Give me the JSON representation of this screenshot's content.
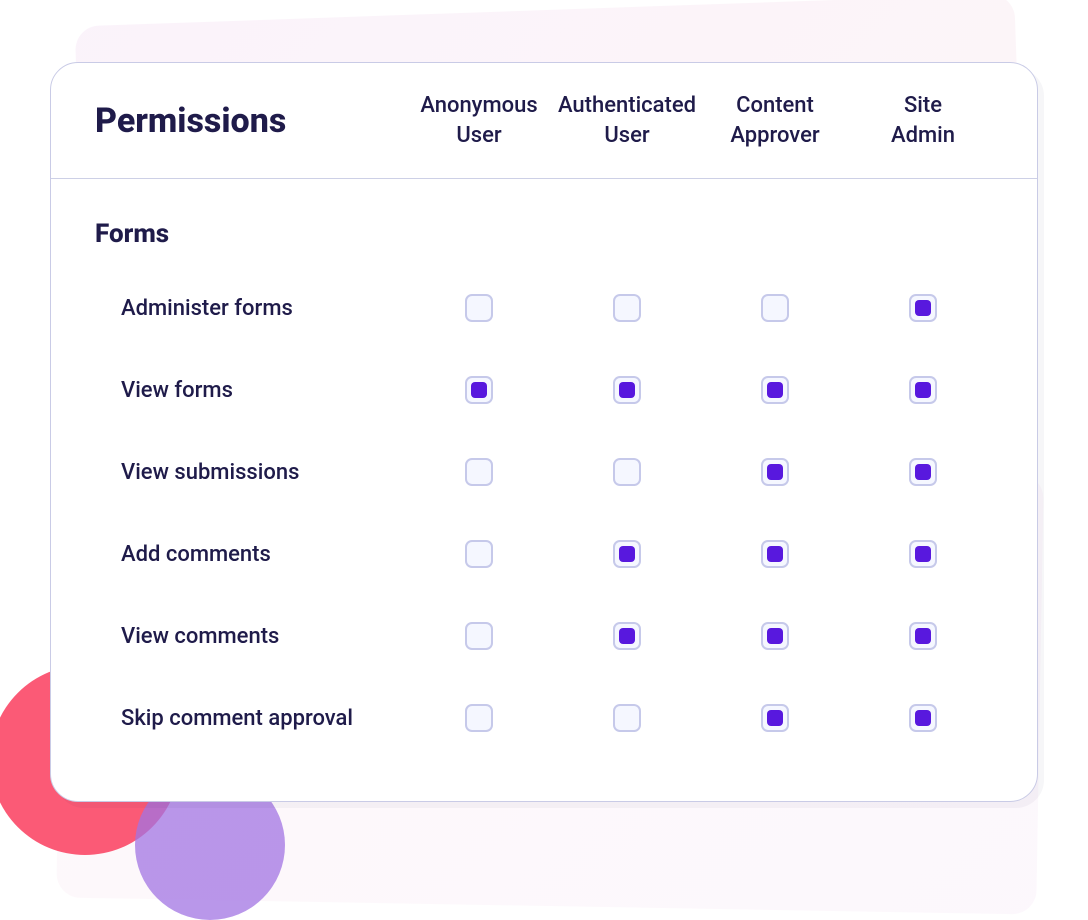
{
  "header": {
    "title": "Permissions",
    "roles": [
      {
        "line1": "Anonymous",
        "line2": "User"
      },
      {
        "line1": "Authenticated",
        "line2": "User"
      },
      {
        "line1": "Content",
        "line2": "Approver"
      },
      {
        "line1": "Site",
        "line2": "Admin"
      }
    ]
  },
  "section": {
    "heading": "Forms",
    "permissions": [
      {
        "label": "Administer forms",
        "values": [
          false,
          false,
          false,
          true
        ]
      },
      {
        "label": "View forms",
        "values": [
          true,
          true,
          true,
          true
        ]
      },
      {
        "label": "View submissions",
        "values": [
          false,
          false,
          true,
          true
        ]
      },
      {
        "label": "Add comments",
        "values": [
          false,
          true,
          true,
          true
        ]
      },
      {
        "label": "View comments",
        "values": [
          false,
          true,
          true,
          true
        ]
      },
      {
        "label": "Skip comment approval",
        "values": [
          false,
          false,
          true,
          true
        ]
      }
    ]
  }
}
